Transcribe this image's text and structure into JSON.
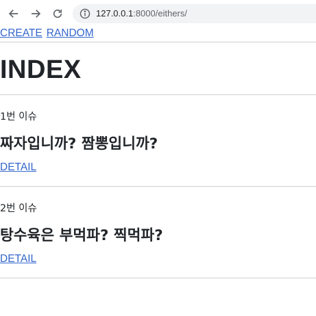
{
  "browser": {
    "url_host": "127.0.0.1",
    "url_rest": ":8000/eithers/",
    "back_icon": "arrow-left-icon",
    "forward_icon": "arrow-right-icon",
    "reload_icon": "reload-icon",
    "info_icon": "info-icon"
  },
  "nav": {
    "create_label": "CREATE",
    "random_label": "RANDOM"
  },
  "page_title": "INDEX",
  "issues": [
    {
      "label": "1번 이슈",
      "title": "짜자입니까? 짬뽕입니까?",
      "detail_label": "DETAIL"
    },
    {
      "label": "2번 이슈",
      "title": "탕수육은 부먹파? 찍먹파?",
      "detail_label": "DETAIL"
    }
  ],
  "colors": {
    "link": "#3366cc",
    "text": "#212529",
    "divider": "#cfcfcf"
  }
}
